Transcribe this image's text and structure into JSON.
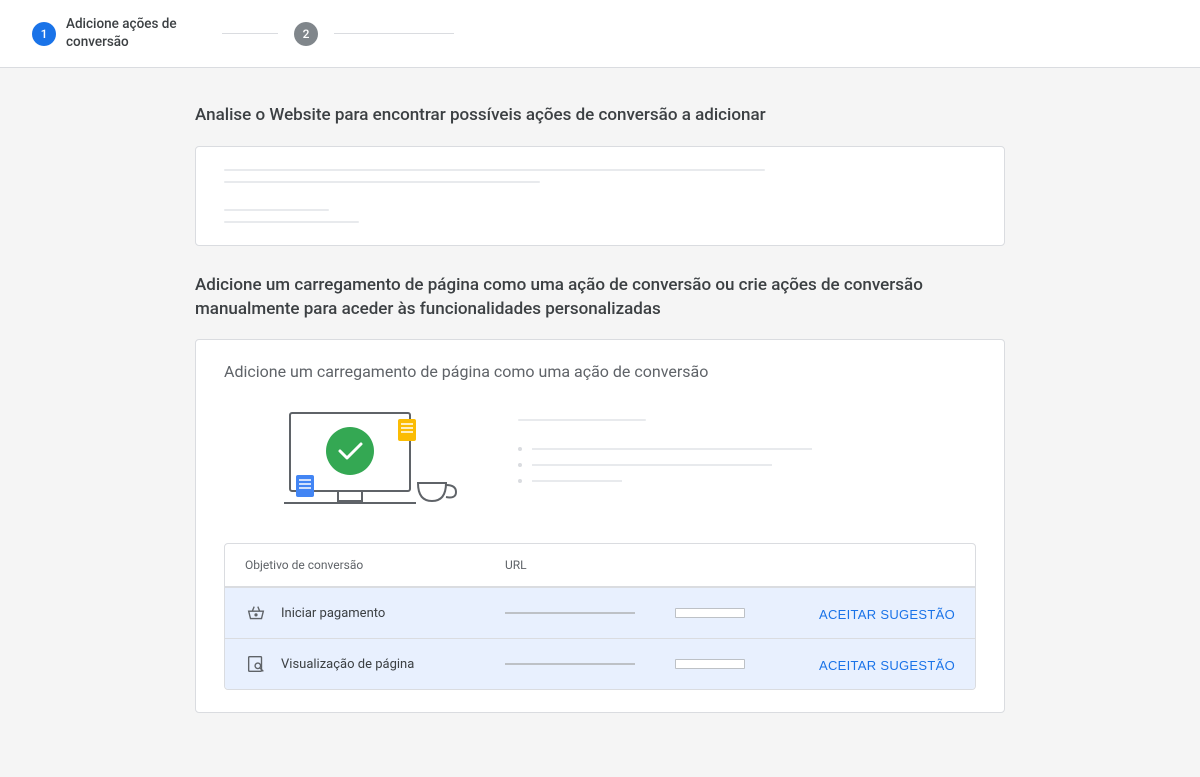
{
  "stepper": {
    "step1": {
      "number": "1",
      "label": "Adicione ações de conversão"
    },
    "step2": {
      "number": "2"
    }
  },
  "section1_title": "Analise o Website para encontrar possíveis ações de conversão a adicionar",
  "section2_title": "Adicione um carregamento de página como uma ação de conversão ou crie ações de conversão manualmente para aceder às funcionalidades personalizadas",
  "card2_title": "Adicione um carregamento de página como uma ação de conversão",
  "table": {
    "header_goal": "Objetivo de conversão",
    "header_url": "URL",
    "rows": [
      {
        "icon": "basket",
        "goal": "Iniciar pagamento",
        "action": "ACEITAR SUGESTÃO"
      },
      {
        "icon": "pageview",
        "goal": "Visualização de página",
        "action": "ACEITAR SUGESTÃO"
      }
    ]
  }
}
